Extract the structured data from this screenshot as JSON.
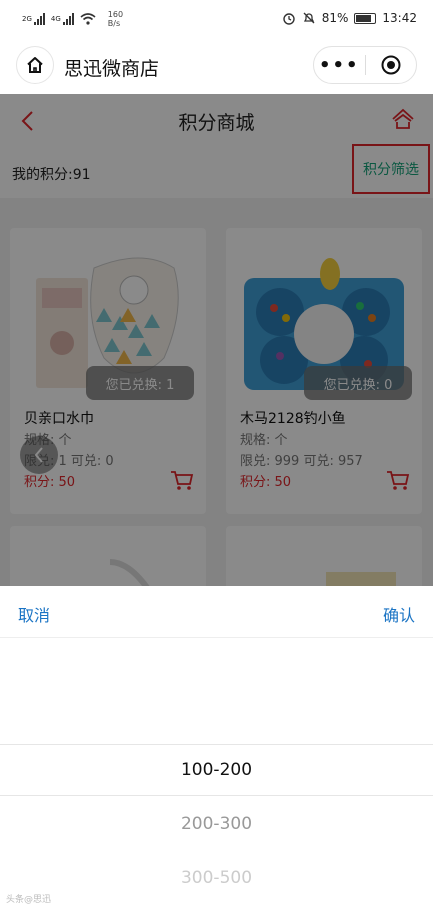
{
  "status_bar": {
    "network_left": "2G",
    "network_right": "4G",
    "speed_value": "160",
    "speed_unit": "B/s",
    "battery": "81%",
    "time": "13:42"
  },
  "mp_header": {
    "title": "思迅微商店",
    "more_label": "•••"
  },
  "page": {
    "nav_title": "积分商城",
    "my_points": "我的积分:91",
    "filter_label": "积分筛选"
  },
  "products": [
    {
      "name": "贝亲口水巾",
      "spec": "规格: 个",
      "limit": "限兑: 1 可兑: 0",
      "points": "积分: 50",
      "redeemed": "您已兑换: 1"
    },
    {
      "name": "木马2128钓小鱼",
      "spec": "规格: 个",
      "limit": "限兑: 999 可兑: 957",
      "points": "积分: 50",
      "redeemed": "您已兑换: 0"
    }
  ],
  "picker": {
    "cancel": "取消",
    "confirm": "确认",
    "options": [
      "100-200",
      "200-300",
      "300-500"
    ],
    "selected_index": 0
  },
  "watermark": "头条@思迅",
  "colors": {
    "accent_red": "#e0262b",
    "filter_green": "#16a37a",
    "picker_blue": "#1b74c4"
  }
}
